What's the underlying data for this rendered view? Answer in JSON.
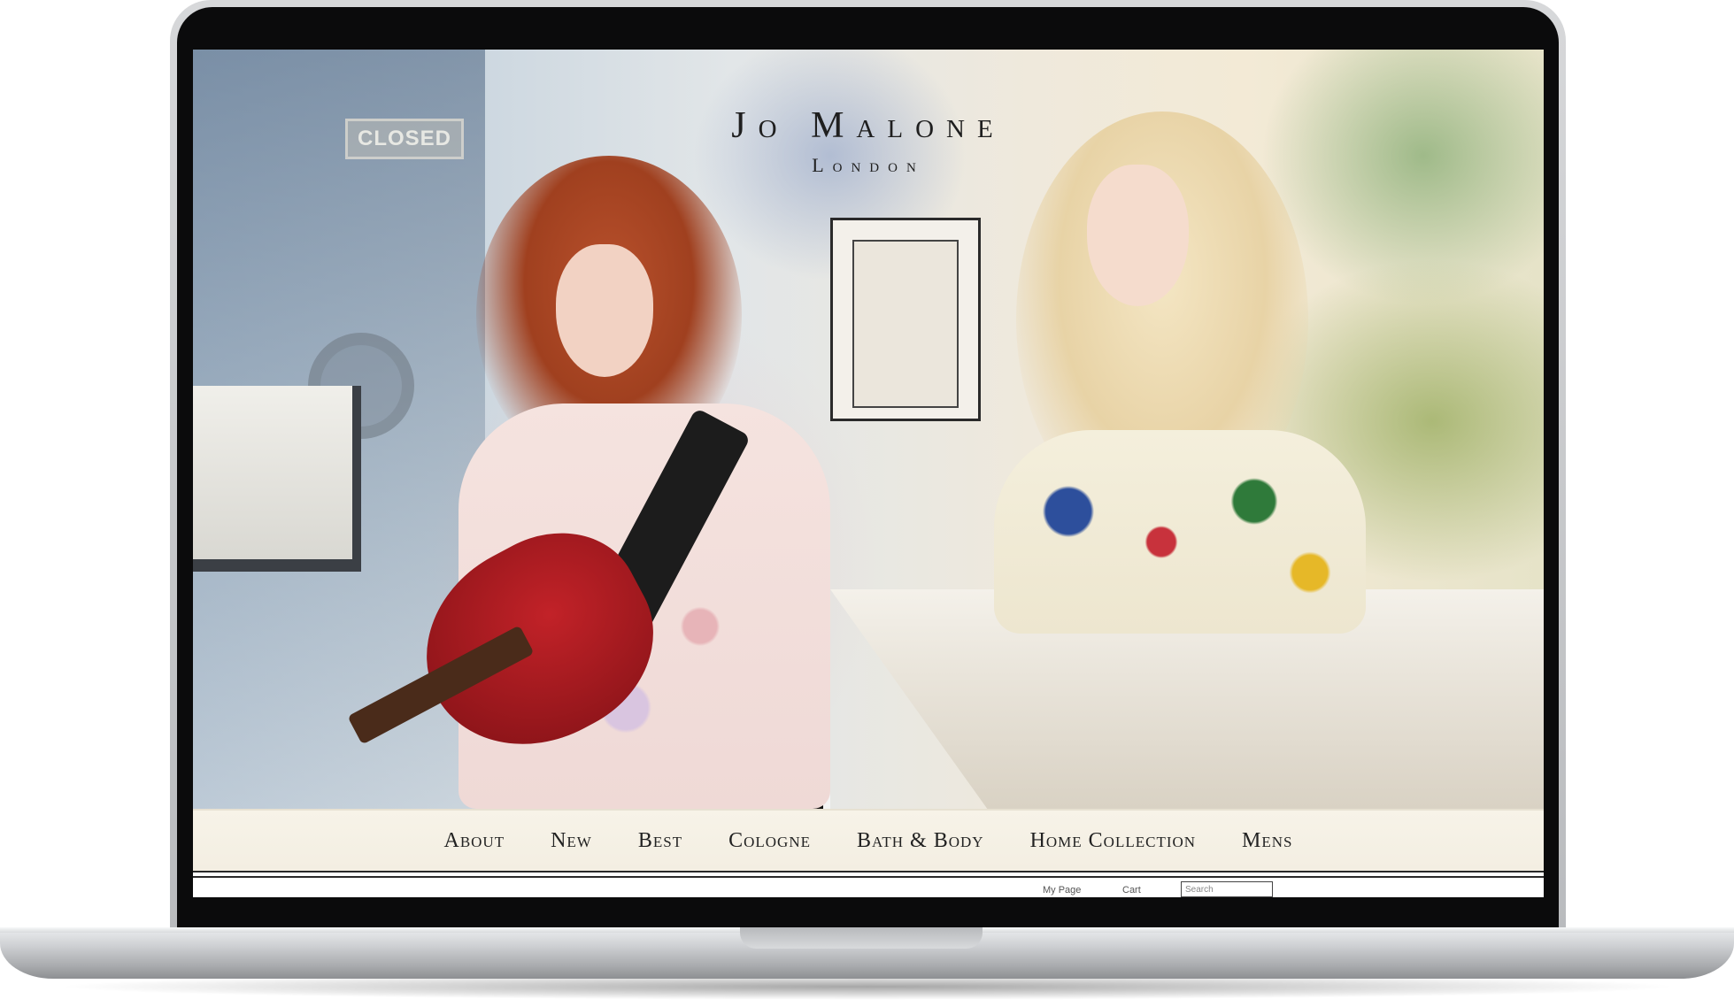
{
  "brand": {
    "name": "Jo Malone",
    "location": "London"
  },
  "hero": {
    "sign_text": "CLOSED"
  },
  "nav": {
    "items": [
      {
        "label": "About"
      },
      {
        "label": "New"
      },
      {
        "label": "Best"
      },
      {
        "label": "Cologne"
      },
      {
        "label": "Bath & Body"
      },
      {
        "label": "Home Collection"
      },
      {
        "label": "Mens"
      }
    ]
  },
  "utility": {
    "my_page": "My Page",
    "cart": "Cart",
    "search_placeholder": "Search"
  },
  "colors": {
    "nav_background": "#f5f0e4",
    "text": "#222222",
    "laptop_silver": "#c8cacd"
  }
}
